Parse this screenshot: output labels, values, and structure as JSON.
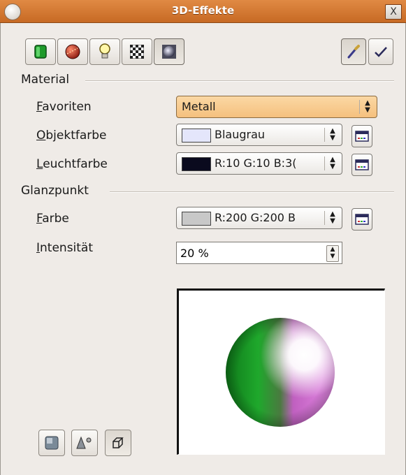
{
  "window": {
    "title": "3D-Effekte",
    "close_glyph": "X"
  },
  "toolbar": {
    "buttons": [
      {
        "name": "geometry",
        "icon": "green-cube-icon"
      },
      {
        "name": "shading",
        "icon": "red-sphere-icon"
      },
      {
        "name": "illumination",
        "icon": "light-bulb-icon"
      },
      {
        "name": "textures",
        "icon": "checkerboard-icon"
      },
      {
        "name": "material",
        "icon": "material-sphere-icon",
        "pressed": true
      }
    ],
    "assign_icon": "pipette-icon",
    "apply_icon": "checkmark-icon"
  },
  "material": {
    "section_title": "Material",
    "favorites": {
      "label_mnemonic": "F",
      "label_rest": "avoriten",
      "value": "Metall"
    },
    "object_color": {
      "label_mnemonic": "O",
      "label_rest": "bjektfarbe",
      "value": "Blaugrau",
      "swatch": "#e4e6fb"
    },
    "illumination_color": {
      "label_mnemonic": "L",
      "label_rest": "euchtfarbe",
      "value": "R:10 G:10 B:3(",
      "swatch": "#0a0a1e"
    }
  },
  "specular": {
    "section_title": "Glanzpunkt",
    "color": {
      "label_mnemonic": "F",
      "label_rest": "arbe",
      "value": "R:200 G:200 B",
      "swatch": "#c8c8c8"
    },
    "intensity": {
      "label_mnemonic": "I",
      "label_rest": "ntensität",
      "value": "20 %"
    }
  },
  "colors": {
    "titlebar": "#d77a34",
    "favorites_highlight": "#f7c88a",
    "sphere_green": "#1a9a2a",
    "sphere_pink": "#f080f0"
  }
}
